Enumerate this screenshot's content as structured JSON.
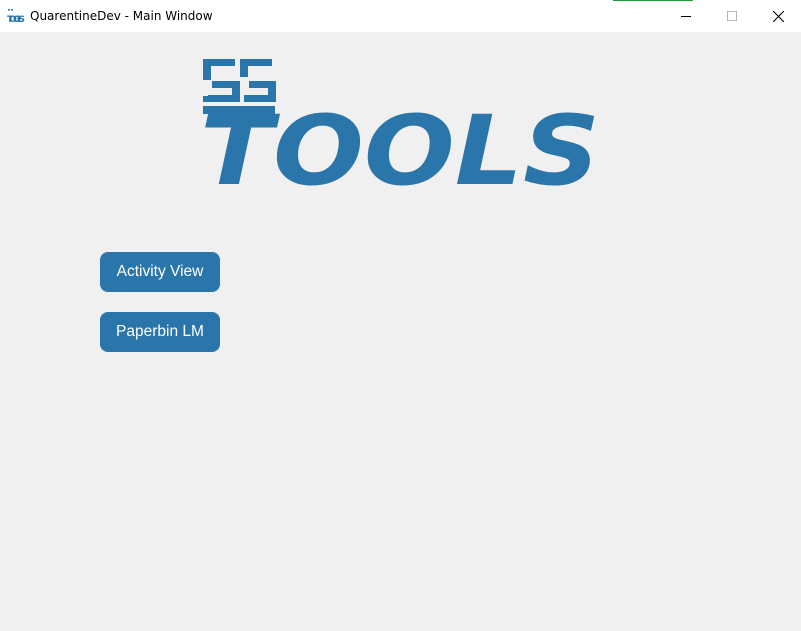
{
  "window": {
    "title": "QuarentineDev - Main Window"
  },
  "logo": {
    "top_text": "SS",
    "main_text": "TOOLS",
    "color": "#2a75aa"
  },
  "buttons": {
    "activity_view": "Activity View",
    "paperbin_lm": "Paperbin LM"
  },
  "icons": {
    "app": "ss-tools-app-icon",
    "minimize": "minimize-icon",
    "maximize": "maximize-icon",
    "close": "close-icon"
  }
}
